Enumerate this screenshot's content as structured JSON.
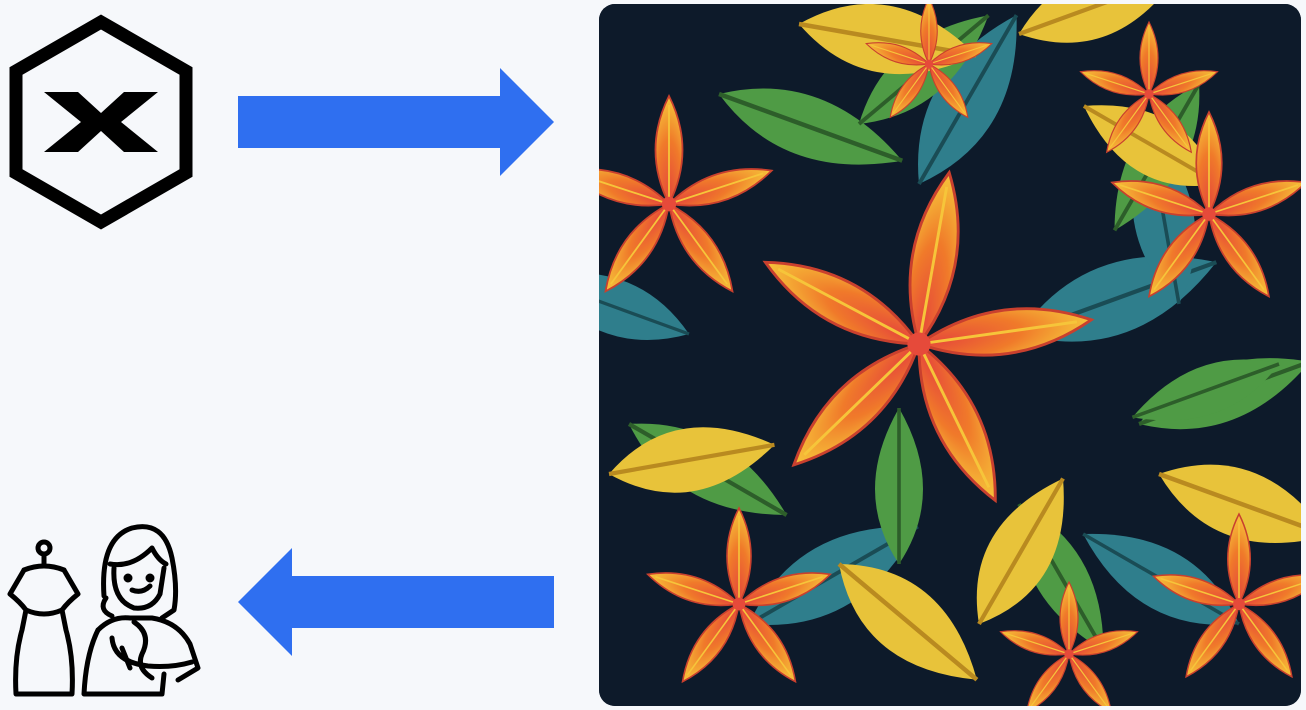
{
  "colors": {
    "background": "#f6f8fb",
    "arrow": "#2f6ff0",
    "icon": "#000000",
    "pattern_bg": "#0d1a2a",
    "flower_orange": "#f07a2a",
    "flower_yellow": "#f6c53a",
    "flower_red": "#e64a3a",
    "leaf_green": "#4f9b45",
    "leaf_teal": "#2f7e8c",
    "leaf_yellow": "#e8c33a"
  },
  "nodes": {
    "logo": {
      "icon": "hexagon-x-logo-icon"
    },
    "designer": {
      "icon": "fashion-designer-with-mannequin-icon"
    },
    "pattern": {
      "icon": "tropical-floral-pattern-image"
    }
  },
  "edges": [
    {
      "from": "logo",
      "to": "pattern",
      "direction": "right"
    },
    {
      "from": "pattern",
      "to": "designer",
      "direction": "left"
    }
  ]
}
